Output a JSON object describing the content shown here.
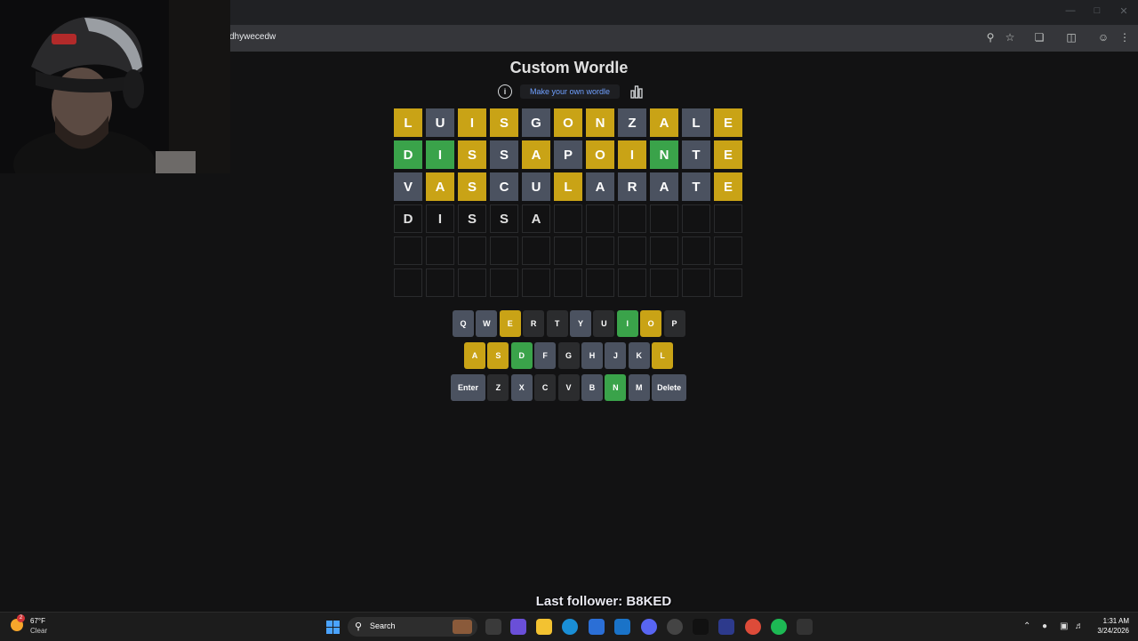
{
  "browser": {
    "url": "dhywecedw",
    "window_controls": [
      "minimize",
      "restore",
      "close"
    ]
  },
  "app": {
    "title": "Custom Wordle",
    "make_link": "Make your own wordle"
  },
  "colors": {
    "correct": "#3aa34a",
    "present": "#c9a316",
    "absent": "#4b5260",
    "key_unused": "#2b2c2e",
    "page_bg": "#121213"
  },
  "board": {
    "rows": [
      {
        "letters": [
          "L",
          "U",
          "I",
          "S",
          "G",
          "O",
          "N",
          "Z",
          "A",
          "L",
          "E"
        ],
        "states": [
          "present",
          "absent",
          "present",
          "present",
          "absent",
          "present",
          "present",
          "absent",
          "present",
          "absent",
          "present"
        ]
      },
      {
        "letters": [
          "D",
          "I",
          "S",
          "S",
          "A",
          "P",
          "O",
          "I",
          "N",
          "T",
          "E"
        ],
        "states": [
          "correct",
          "correct",
          "present",
          "absent",
          "present",
          "absent",
          "present",
          "present",
          "correct",
          "absent",
          "present"
        ]
      },
      {
        "letters": [
          "V",
          "A",
          "S",
          "C",
          "U",
          "L",
          "A",
          "R",
          "A",
          "T",
          "E"
        ],
        "states": [
          "absent",
          "present",
          "present",
          "absent",
          "absent",
          "present",
          "absent",
          "absent",
          "absent",
          "absent",
          "present"
        ]
      },
      {
        "letters": [
          "D",
          "I",
          "S",
          "S",
          "A",
          "",
          "",
          "",
          "",
          "",
          ""
        ],
        "states": [
          "pending",
          "pending",
          "pending",
          "pending",
          "pending",
          "empty",
          "empty",
          "empty",
          "empty",
          "empty",
          "empty"
        ]
      },
      {
        "letters": [
          "",
          "",
          "",
          "",
          "",
          "",
          "",
          "",
          "",
          "",
          ""
        ],
        "states": [
          "empty",
          "empty",
          "empty",
          "empty",
          "empty",
          "empty",
          "empty",
          "empty",
          "empty",
          "empty",
          "empty"
        ]
      },
      {
        "letters": [
          "",
          "",
          "",
          "",
          "",
          "",
          "",
          "",
          "",
          "",
          ""
        ],
        "states": [
          "empty",
          "empty",
          "empty",
          "empty",
          "empty",
          "empty",
          "empty",
          "empty",
          "empty",
          "empty",
          "empty"
        ]
      }
    ]
  },
  "keyboard": {
    "rows": [
      [
        {
          "label": "Q",
          "state": "absent"
        },
        {
          "label": "W",
          "state": "absent"
        },
        {
          "label": "E",
          "state": "present"
        },
        {
          "label": "R",
          "state": "unused"
        },
        {
          "label": "T",
          "state": "unused"
        },
        {
          "label": "Y",
          "state": "absent"
        },
        {
          "label": "U",
          "state": "unused"
        },
        {
          "label": "I",
          "state": "correct"
        },
        {
          "label": "O",
          "state": "present"
        },
        {
          "label": "P",
          "state": "unused"
        }
      ],
      [
        {
          "label": "A",
          "state": "present"
        },
        {
          "label": "S",
          "state": "present"
        },
        {
          "label": "D",
          "state": "correct"
        },
        {
          "label": "F",
          "state": "absent"
        },
        {
          "label": "G",
          "state": "unused"
        },
        {
          "label": "H",
          "state": "absent"
        },
        {
          "label": "J",
          "state": "absent"
        },
        {
          "label": "K",
          "state": "absent"
        },
        {
          "label": "L",
          "state": "present"
        }
      ],
      [
        {
          "label": "Enter",
          "state": "absent",
          "wide": true
        },
        {
          "label": "Z",
          "state": "unused"
        },
        {
          "label": "X",
          "state": "absent"
        },
        {
          "label": "C",
          "state": "unused"
        },
        {
          "label": "V",
          "state": "unused"
        },
        {
          "label": "B",
          "state": "absent"
        },
        {
          "label": "N",
          "state": "correct"
        },
        {
          "label": "M",
          "state": "absent"
        },
        {
          "label": "Delete",
          "state": "absent",
          "wide": true
        }
      ]
    ]
  },
  "overlay": {
    "last_follower": "Last follower: B8KED"
  },
  "taskbar": {
    "weather_temp": "67°F",
    "weather_desc": "Clear",
    "weather_badge": "2",
    "search_label": "Search",
    "time": "1:31 AM",
    "date": "3/24/2026"
  }
}
